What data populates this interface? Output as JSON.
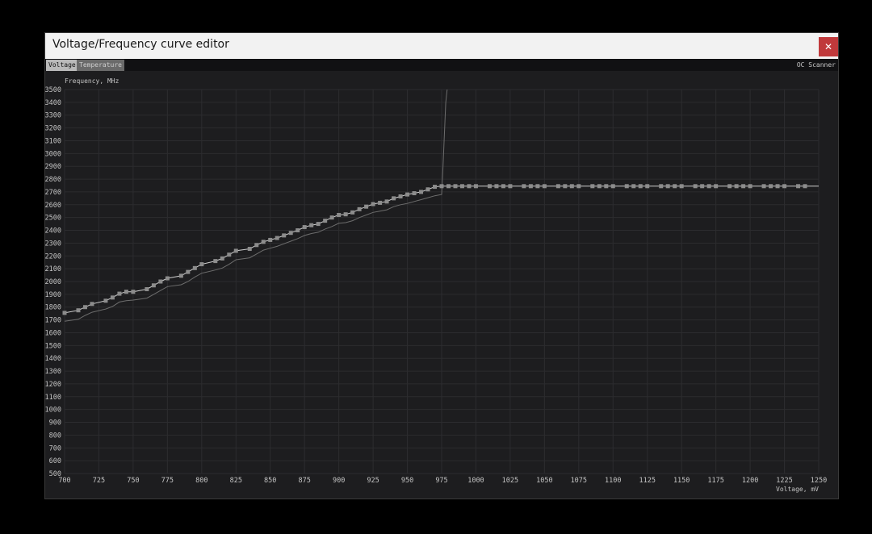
{
  "window": {
    "title": "Voltage/Frequency curve editor",
    "close_label": "✕",
    "close_icon": "close-icon"
  },
  "tabs": [
    {
      "label": "Voltage",
      "active": true
    },
    {
      "label": "Temperature",
      "active": false
    }
  ],
  "oc_scanner_label": "OC Scanner",
  "colors": {
    "background": "#1d1d1f",
    "grid": "#2c2c2f",
    "curve": "#cfcfcf",
    "point": "#8c8c8c",
    "base_curve": "#6d6d6d",
    "close_button": "#c0393b"
  },
  "chart_data": {
    "type": "line",
    "xlabel": "Voltage, mV",
    "ylabel": "Frequency, MHz",
    "xlim": [
      700,
      1250
    ],
    "ylim": [
      500,
      3500
    ],
    "x_ticks": [
      700,
      725,
      750,
      775,
      800,
      825,
      850,
      875,
      900,
      925,
      950,
      975,
      1000,
      1025,
      1050,
      1075,
      1100,
      1125,
      1150,
      1175,
      1200,
      1225,
      1250
    ],
    "y_ticks": [
      500,
      600,
      700,
      800,
      900,
      1000,
      1100,
      1200,
      1300,
      1400,
      1500,
      1600,
      1700,
      1800,
      1900,
      2000,
      2100,
      2200,
      2300,
      2400,
      2500,
      2600,
      2700,
      2800,
      2900,
      3000,
      3100,
      3200,
      3300,
      3400,
      3500
    ],
    "grid": true,
    "series": [
      {
        "role": "curve",
        "x": [
          700,
          710,
          715,
          720,
          730,
          735,
          740,
          745,
          750,
          760,
          765,
          770,
          775,
          785,
          790,
          795,
          800,
          810,
          815,
          820,
          825,
          835,
          840,
          845,
          850,
          855,
          860,
          865,
          870,
          875,
          880,
          885,
          890,
          895,
          900,
          905,
          910,
          915,
          920,
          925,
          930,
          935,
          940,
          945,
          950,
          955,
          960,
          965,
          970,
          975
        ],
        "y": [
          1755,
          1775,
          1800,
          1825,
          1850,
          1875,
          1905,
          1920,
          1920,
          1940,
          1970,
          2000,
          2025,
          2045,
          2075,
          2105,
          2135,
          2160,
          2180,
          2210,
          2240,
          2255,
          2285,
          2310,
          2325,
          2340,
          2360,
          2380,
          2400,
          2425,
          2440,
          2450,
          2475,
          2500,
          2520,
          2525,
          2540,
          2565,
          2585,
          2605,
          2615,
          2625,
          2650,
          2665,
          2680,
          2690,
          2700,
          2720,
          2740,
          2745
        ]
      },
      {
        "role": "curve-flat",
        "x": [
          975,
          1250
        ],
        "y": [
          2745,
          2745
        ]
      },
      {
        "role": "flat-points",
        "x": [
          980,
          985,
          990,
          995,
          1000,
          1010,
          1015,
          1020,
          1025,
          1035,
          1040,
          1045,
          1050,
          1060,
          1065,
          1070,
          1075,
          1085,
          1090,
          1095,
          1100,
          1110,
          1115,
          1120,
          1125,
          1135,
          1140,
          1145,
          1150,
          1160,
          1165,
          1170,
          1175,
          1185,
          1190,
          1195,
          1200,
          1210,
          1215,
          1220,
          1225,
          1235,
          1240
        ],
        "y": [
          2745,
          2745,
          2745,
          2745,
          2745,
          2745,
          2745,
          2745,
          2745,
          2745,
          2745,
          2745,
          2745,
          2745,
          2745,
          2745,
          2745,
          2745,
          2745,
          2745,
          2745,
          2745,
          2745,
          2745,
          2745,
          2745,
          2745,
          2745,
          2745,
          2745,
          2745,
          2745,
          2745,
          2745,
          2745,
          2745,
          2745,
          2745,
          2745,
          2745,
          2745,
          2745,
          2745
        ]
      },
      {
        "role": "base-curve",
        "x": [
          700,
          710,
          715,
          720,
          730,
          735,
          740,
          745,
          750,
          760,
          765,
          770,
          775,
          785,
          790,
          795,
          800,
          810,
          815,
          820,
          825,
          835,
          840,
          845,
          850,
          855,
          860,
          865,
          870,
          875,
          880,
          885,
          890,
          895,
          900,
          905,
          910,
          915,
          920,
          925,
          930,
          935,
          940,
          945,
          950,
          955,
          960,
          965,
          970,
          975,
          976,
          977,
          978,
          979
        ],
        "y": [
          1690,
          1705,
          1735,
          1760,
          1785,
          1805,
          1840,
          1850,
          1855,
          1870,
          1900,
          1930,
          1960,
          1975,
          2000,
          2035,
          2065,
          2090,
          2105,
          2135,
          2170,
          2185,
          2215,
          2245,
          2260,
          2275,
          2295,
          2315,
          2335,
          2360,
          2375,
          2385,
          2410,
          2430,
          2455,
          2460,
          2475,
          2500,
          2520,
          2540,
          2550,
          2560,
          2585,
          2600,
          2610,
          2625,
          2640,
          2655,
          2670,
          2680,
          2900,
          3150,
          3400,
          3500
        ]
      }
    ]
  }
}
